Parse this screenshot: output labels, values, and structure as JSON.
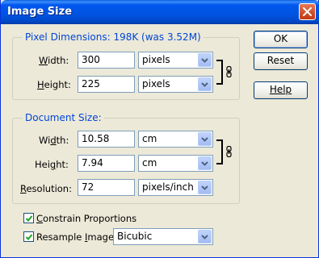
{
  "window": {
    "title": "Image Size"
  },
  "buttons": {
    "ok": "OK",
    "reset": "Reset",
    "help": "Help"
  },
  "pixel_dimensions": {
    "legend": "Pixel Dimensions:  198K (was 3.52M)",
    "width": {
      "label_u": "W",
      "label_rest": "idth:",
      "value": "300",
      "unit": "pixels"
    },
    "height": {
      "label_u": "H",
      "label_rest": "eight:",
      "value": "225",
      "unit": "pixels"
    }
  },
  "document_size": {
    "legend": "Document Size:",
    "width": {
      "label_pre": "Wi",
      "label_u": "d",
      "label_rest": "th:",
      "value": "10.58",
      "unit": "cm"
    },
    "height": {
      "label_pre": "Hei",
      "label_u": "g",
      "label_rest": "ht:",
      "value": "7.94",
      "unit": "cm"
    },
    "resolution": {
      "label_u": "R",
      "label_rest": "esolution:",
      "value": "72",
      "unit": "pixels/inch"
    }
  },
  "options": {
    "constrain": {
      "label_u": "C",
      "label_rest": "onstrain Proportions",
      "checked": true
    },
    "resample": {
      "label_pre": "Resample ",
      "label_u": "I",
      "label_rest": "mage:",
      "checked": true,
      "method": "Bicubic"
    }
  },
  "icons": {
    "close": "close-icon",
    "link": "chain-link-icon",
    "dropdown": "chevron-down-icon",
    "check": "checkmark-icon"
  },
  "colors": {
    "title_blue": "#0054e3",
    "legend_blue": "#0046d5",
    "dialog_bg": "#ece9d8",
    "close_red": "#d4532f"
  }
}
